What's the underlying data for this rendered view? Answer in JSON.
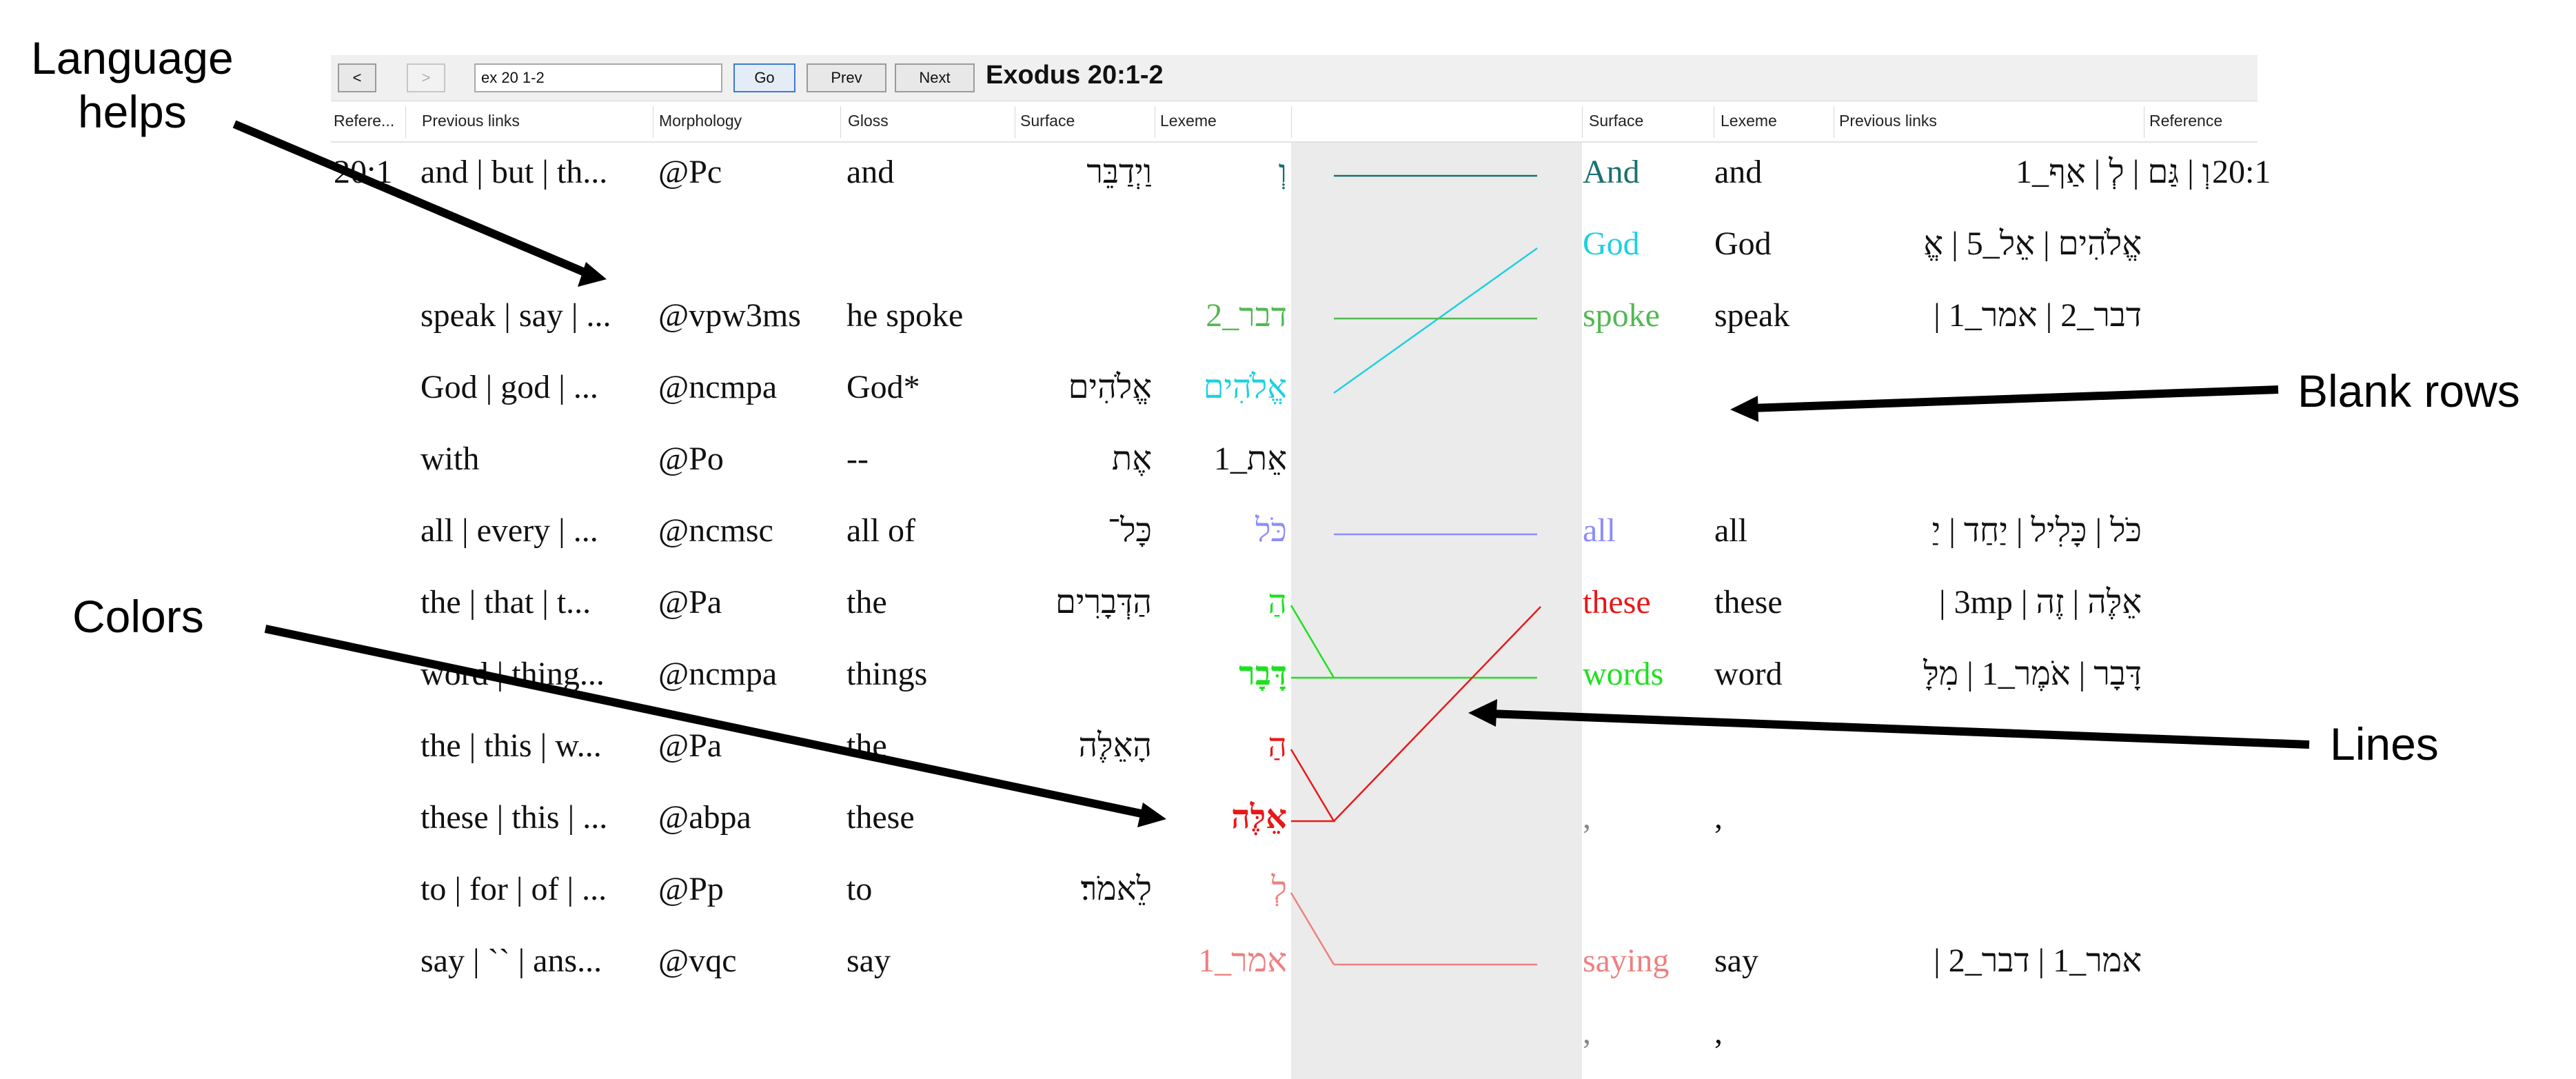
{
  "toolbar": {
    "back_label": "<",
    "forward_label": ">",
    "search_value": "ex 20 1-2",
    "go_label": "Go",
    "prev_label": "Prev",
    "next_label": "Next",
    "title": "Exodus 20:1-2"
  },
  "left_headers": [
    "Refere...",
    "Previous links",
    "Morphology",
    "Gloss",
    "Surface",
    "Lexeme"
  ],
  "right_headers": [
    "Surface",
    "Lexeme",
    "Previous links",
    "Reference"
  ],
  "left_rows": [
    {
      "ref": "20:1",
      "links": "and | but | th...",
      "morph": "@Pc",
      "gloss": "and",
      "surface": "וַיְדַבֵּר",
      "lexeme": "וְ"
    },
    {
      "ref": "",
      "links": "",
      "morph": "",
      "gloss": "",
      "surface": "",
      "lexeme": ""
    },
    {
      "ref": "",
      "links": "speak | say | ...",
      "morph": "@vpw3ms",
      "gloss": "he spoke",
      "surface": "",
      "lexeme": "דבר_2"
    },
    {
      "ref": "",
      "links": "God | god | ...",
      "morph": "@ncmpa",
      "gloss": "God*",
      "surface": "אֱלֹהִים",
      "lexeme": "אֱלֹהִים"
    },
    {
      "ref": "",
      "links": "with",
      "morph": "@Po",
      "gloss": "--",
      "surface": "אֶת",
      "lexeme": "אֵת_1"
    },
    {
      "ref": "",
      "links": "all | every | ...",
      "morph": "@ncmsc",
      "gloss": "all of",
      "surface": "כָּל־",
      "lexeme": "כֹּל"
    },
    {
      "ref": "",
      "links": "the | that | t...",
      "morph": "@Pa",
      "gloss": "the",
      "surface": "הַדְּבָרִים",
      "lexeme": "הַ"
    },
    {
      "ref": "",
      "links": "word | thing...",
      "morph": "@ncmpa",
      "gloss": "things",
      "surface": "",
      "lexeme": "דָּבָר"
    },
    {
      "ref": "",
      "links": "the | this | w...",
      "morph": "@Pa",
      "gloss": "the",
      "surface": "הָאֵלֶּה",
      "lexeme": "הַ"
    },
    {
      "ref": "",
      "links": "these | this | ...",
      "morph": "@abpa",
      "gloss": "these",
      "surface": "",
      "lexeme": "אֵלֶּה"
    },
    {
      "ref": "",
      "links": "to | for | of | ...",
      "morph": "@Pp",
      "gloss": "to",
      "surface": "לֵאמֹר׃",
      "lexeme": "לְ"
    },
    {
      "ref": "",
      "links": "say | `` | ans...",
      "morph": "@vqc",
      "gloss": "say",
      "surface": "",
      "lexeme": "אמר_1"
    }
  ],
  "right_rows": [
    {
      "surface": "And",
      "lexeme": "and",
      "links": "וְ | גַּם | לְ | אַף_1",
      "ref": "20:1"
    },
    {
      "surface": "God",
      "lexeme": "God",
      "links": "אֱלֹהִים | אֵל_5 | אֱ",
      "ref": ""
    },
    {
      "surface": "spoke",
      "lexeme": "speak",
      "links": "דבר_2 | אמר_1 |",
      "ref": ""
    },
    {
      "surface": "",
      "lexeme": "",
      "links": "",
      "ref": ""
    },
    {
      "surface": "",
      "lexeme": "",
      "links": "",
      "ref": ""
    },
    {
      "surface": "all",
      "lexeme": "all",
      "links": "כֹּל | כָּלִיל | יַחַד | יַ",
      "ref": ""
    },
    {
      "surface": "these",
      "lexeme": "these",
      "links": "אֵלֶּה | זֶה | 3mp | ",
      "ref": ""
    },
    {
      "surface": "words",
      "lexeme": "word",
      "links": "דָּבָר | אֹמֶר_1 | מִלָּ",
      "ref": ""
    },
    {
      "surface": "",
      "lexeme": "",
      "links": "",
      "ref": ""
    },
    {
      "surface": ",",
      "lexeme": ",",
      "links": "",
      "ref": ""
    },
    {
      "surface": "",
      "lexeme": "",
      "links": "",
      "ref": ""
    },
    {
      "surface": "saying",
      "lexeme": "say",
      "links": "אמר_1 | דבר_2 |",
      "ref": ""
    },
    {
      "surface": ",",
      "lexeme": ",",
      "links": "",
      "ref": ""
    }
  ],
  "colors": {
    "teal": "#1a7070",
    "cyan": "#1ed0e0",
    "green": "#52b852",
    "bright_green": "#1ee01e",
    "lavender": "#8c8cff",
    "red": "#e81818",
    "pink": "#ee8080"
  },
  "annotations": {
    "language_helps": "Language\nhelps",
    "blank_rows": "Blank rows",
    "colors": "Colors",
    "lines": "Lines"
  }
}
